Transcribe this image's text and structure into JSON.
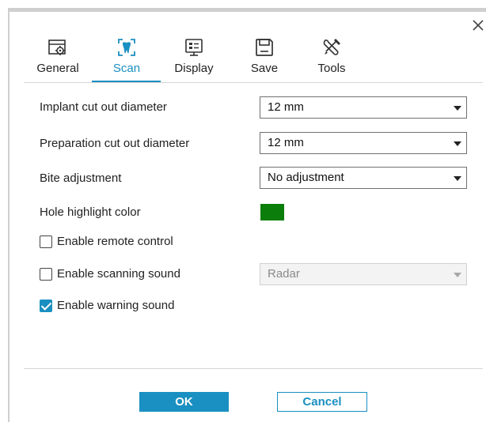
{
  "tabs": [
    {
      "label": "General",
      "icon": "settings-window-icon"
    },
    {
      "label": "Scan",
      "icon": "tooth-scan-icon"
    },
    {
      "label": "Display",
      "icon": "monitor-icon"
    },
    {
      "label": "Save",
      "icon": "floppy-disk-icon"
    },
    {
      "label": "Tools",
      "icon": "wrench-screwdriver-icon"
    }
  ],
  "active_tab": "Scan",
  "settings": {
    "implant_cut_out": {
      "label": "Implant cut out diameter",
      "value": "12 mm"
    },
    "preparation_cut_out": {
      "label": "Preparation cut out diameter",
      "value": "12 mm"
    },
    "bite_adjustment": {
      "label": "Bite adjustment",
      "value": "No adjustment"
    },
    "hole_highlight": {
      "label": "Hole highlight color",
      "color": "#0a7d0a"
    },
    "remote_control": {
      "label": "Enable remote control",
      "checked": false
    },
    "scanning_sound": {
      "label": "Enable scanning sound",
      "checked": false,
      "sound_value": "Radar",
      "sound_enabled": false
    },
    "warning_sound": {
      "label": "Enable warning sound",
      "checked": true
    }
  },
  "footer": {
    "ok_label": "OK",
    "cancel_label": "Cancel"
  },
  "colors": {
    "accent": "#1a8fc1",
    "highlight": "#0a7d0a"
  }
}
